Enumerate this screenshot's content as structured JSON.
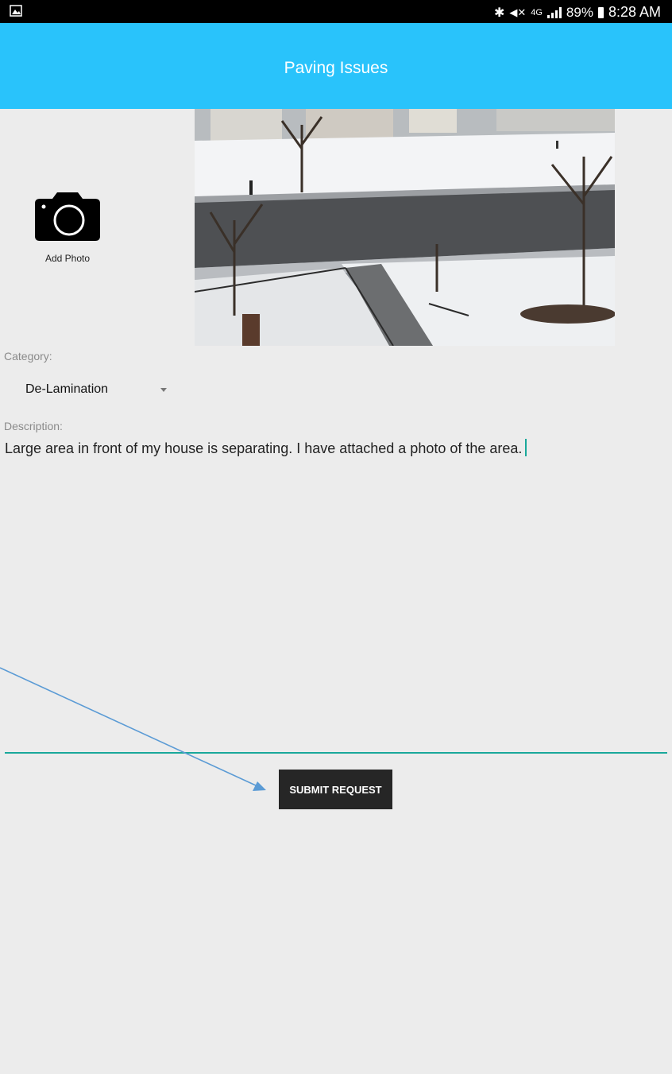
{
  "status_bar": {
    "battery_percent": "89%",
    "time": "8:28 AM",
    "network": "4G"
  },
  "app_bar": {
    "title": "Paving Issues",
    "color": "#29c3fb"
  },
  "add_photo": {
    "label": "Add Photo"
  },
  "form": {
    "category_label": "Category:",
    "category_value": "De-Lamination",
    "description_label": "Description:",
    "description_value": "Large area in front of my house is separating. I have attached a photo of the area."
  },
  "submit": {
    "label": "SUBMIT REQUEST"
  }
}
